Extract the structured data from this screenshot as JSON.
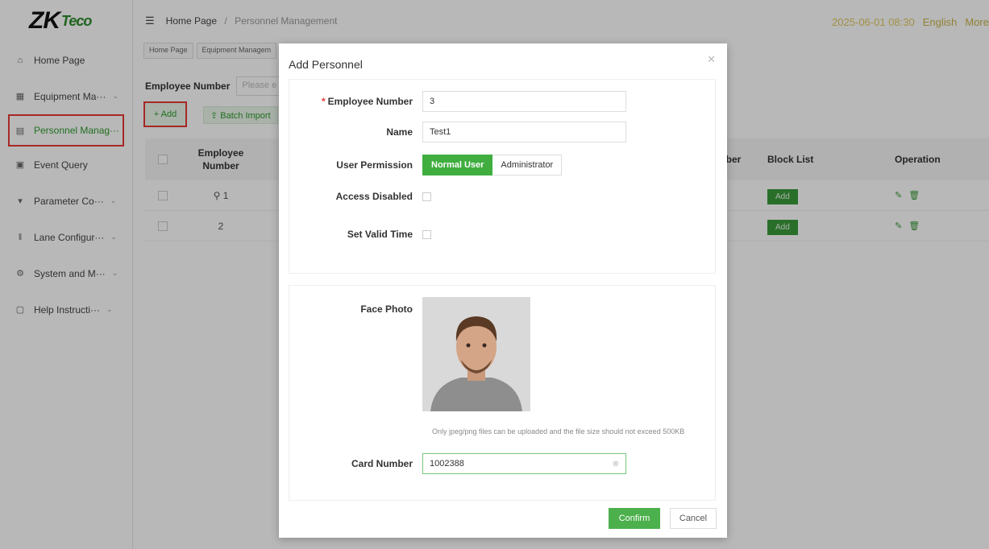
{
  "logo": {
    "main": "ZK",
    "sub": "Teco"
  },
  "header": {
    "breadcrumb_home": "Home Page",
    "breadcrumb_sep": "/",
    "breadcrumb_current": "Personnel Management",
    "datetime": "2025-06-01 08:30",
    "language": "English",
    "more": "More"
  },
  "sidebar": {
    "items": [
      {
        "label": "Home Page",
        "icon": "home-icon"
      },
      {
        "label": "Equipment Ma···",
        "icon": "equipment-icon"
      },
      {
        "label": "Personnel Manag···",
        "icon": "personnel-icon"
      },
      {
        "label": "Event Query",
        "icon": "event-icon"
      },
      {
        "label": "Parameter Co···",
        "icon": "parameter-icon"
      },
      {
        "label": "Lane Configur···",
        "icon": "lane-icon"
      },
      {
        "label": "System and M···",
        "icon": "system-icon"
      },
      {
        "label": "Help Instructi···",
        "icon": "help-icon"
      }
    ]
  },
  "tabs": [
    "Home Page",
    "Equipment Managem"
  ],
  "search": {
    "label": "Employee Number",
    "placeholder": "Please e"
  },
  "toolbar": {
    "add": "+ Add",
    "batch_import": "⇪ Batch Import"
  },
  "table": {
    "headers": {
      "employee_number": "Employee Number",
      "number_tail": "mber",
      "block_list": "Block List",
      "operation": "Operation"
    },
    "rows": [
      {
        "employee_number": "1",
        "block_action": "Add"
      },
      {
        "employee_number": "2",
        "block_action": "Add"
      }
    ]
  },
  "modal": {
    "title": "Add Personnel",
    "fields": {
      "employee_number_label": "Employee Number",
      "employee_number_value": "3",
      "name_label": "Name",
      "name_value": "Test1",
      "permission_label": "User Permission",
      "permission_normal": "Normal User",
      "permission_admin": "Administrator",
      "access_disabled_label": "Access Disabled",
      "valid_time_label": "Set Valid Time",
      "face_photo_label": "Face Photo",
      "photo_hint": "Only jpeg/png files can be uploaded and the file size should not exceed 500KB",
      "card_number_label": "Card Number",
      "card_number_value": "1002388"
    },
    "confirm": "Confirm",
    "cancel": "Cancel"
  },
  "colors": {
    "accent": "#3fae3f",
    "highlight": "#e53935"
  }
}
